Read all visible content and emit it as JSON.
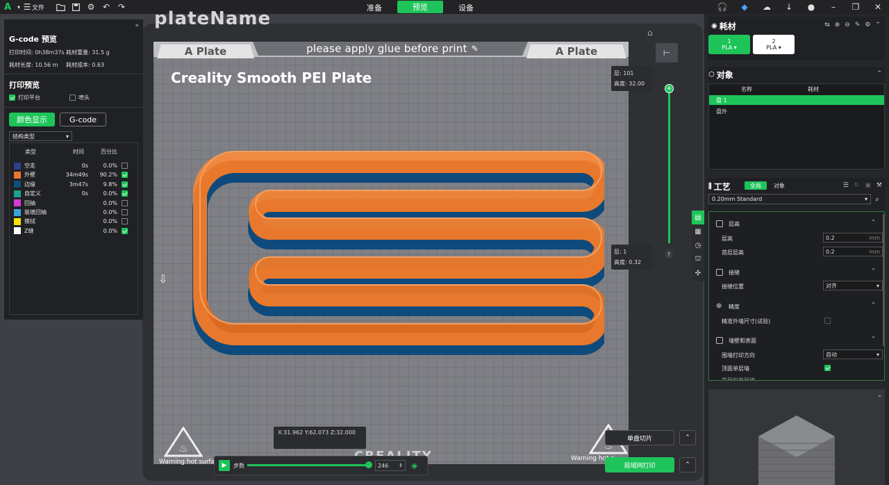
{
  "topbar": {
    "file_label": "文件",
    "tabs": [
      {
        "label": "准备",
        "active": false
      },
      {
        "label": "预览",
        "active": true
      },
      {
        "label": "设备",
        "active": false
      }
    ]
  },
  "plate": {
    "name": "plateName",
    "left_tab": "A Plate",
    "right_tab": "A Plate",
    "glue_notice": "please apply glue before print",
    "bed_title": "Creality Smooth PEI Plate",
    "warning_left": "Warning hot surfa",
    "warning_right": "Warning hot s",
    "brand": "CREALITY",
    "coords": "X:31.962  Y:62.073  Z:32.000"
  },
  "gcode": {
    "title": "G-code 预览",
    "print_time": "打印时间: 0h38m37s",
    "weight": "耗材重量: 31.5 g",
    "length": "耗材长度: 10.56 m",
    "cost": "耗材成本: 0.63",
    "preview_title": "打印预览",
    "opt_bed": "打印平台",
    "opt_nozzle": "喷头",
    "btn_color": "颜色显示",
    "btn_gcode": "G-code",
    "dropdown": "结构类型",
    "headers": {
      "type": "类型",
      "time": "时间",
      "pct": "百分比"
    },
    "legend": [
      {
        "name": "空走",
        "time": "0s",
        "pct": "0.0%",
        "color": "#2f3e8f",
        "on": false
      },
      {
        "name": "外壁",
        "time": "34m49s",
        "pct": "90.2%",
        "color": "#e87a30",
        "on": true
      },
      {
        "name": "边缘",
        "time": "3m47s",
        "pct": "9.8%",
        "color": "#104c7a",
        "on": true
      },
      {
        "name": "自定义",
        "time": "0s",
        "pct": "0.0%",
        "color": "#19a38d",
        "on": true
      },
      {
        "name": "回抽",
        "time": "",
        "pct": "0.0%",
        "color": "#d63ad8",
        "on": false
      },
      {
        "name": "装填回抽",
        "time": "",
        "pct": "0.0%",
        "color": "#37a5d6",
        "on": false
      },
      {
        "name": "擦拭",
        "time": "",
        "pct": "0.0%",
        "color": "#f5e400",
        "on": false
      },
      {
        "name": "Z缝",
        "time": "",
        "pct": "0.0%",
        "color": "#ffffff",
        "on": true
      }
    ]
  },
  "layer_slider": {
    "top_layer": "层: 101",
    "top_height": "高度: 32.00",
    "bottom_layer": "层: 1",
    "bottom_height": "高度: 0.32",
    "help": "?"
  },
  "step_bar": {
    "label": "步数",
    "value": "246"
  },
  "actions": {
    "slice_single": "单盘切片",
    "lan_print": "局域网打印"
  },
  "right": {
    "filament_title": "耗材",
    "filaments": [
      {
        "num": "1",
        "type": "PLA"
      },
      {
        "num": "2",
        "type": "PLA"
      }
    ],
    "objects_title": "对象",
    "obj_col_name": "名称",
    "obj_col_fil": "耗材",
    "objects": [
      "盘 1",
      "盘外"
    ],
    "process_title": "工艺",
    "process_tab_global": "全局",
    "process_tab_object": "对象",
    "preset": "0.20mm Standard",
    "sections": {
      "layer_height": "层高",
      "seam": "接缝",
      "precision": "精度",
      "walls": "墙壁和表面"
    },
    "fields": {
      "layer_height_label": "层高",
      "layer_height_val": "0.2",
      "first_layer_label": "首层层高",
      "first_layer_val": "0.2",
      "unit": "mm",
      "seam_pos_label": "接缝位置",
      "seam_pos_val": "对齐",
      "precise_wall_label": "精准外墙尺寸(试验)",
      "wall_dir_label": "围墙打印方向",
      "wall_dir_val": "自动",
      "top_single_label": "顶面单层墙",
      "first_single_label": "首层仅单层墙"
    }
  }
}
